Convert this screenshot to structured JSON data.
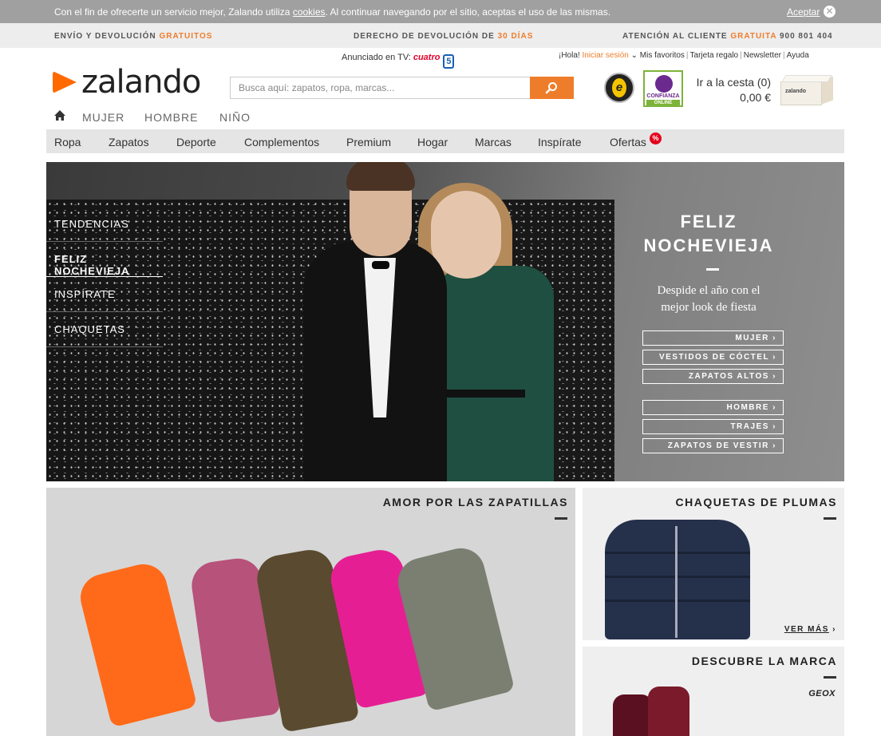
{
  "cookie_bar": {
    "message_before": "Con el fin de ofrecerte un servicio mejor, Zalando utiliza ",
    "cookies_link": "cookies",
    "message_after": ". Al continuar navegando por el sitio, aceptas el uso de las mismas.",
    "accept_label": "Aceptar",
    "close_icon": "close-icon"
  },
  "service_bar": {
    "shipping": {
      "text": "ENVÍO Y DEVOLUCIÓN",
      "highlight": "GRATUITOS"
    },
    "returns": {
      "text": "DERECHO DE DEVOLUCIÓN DE",
      "highlight": "30 DÍAS"
    },
    "support": {
      "text": "ATENCIÓN AL CLIENTE",
      "highlight": "GRATUITA",
      "phone": "900 801 404"
    }
  },
  "header": {
    "logo_text": "zalando",
    "tv_label": "Anunciado en TV:",
    "tv_channel_1": "cuatro",
    "tv_channel_2": "5",
    "search_placeholder": "Busca aquí: zapatos, ropa, marcas...",
    "top_links": {
      "greeting": "¡Hola!",
      "login": "Iniciar sesión",
      "favorites": "Mis favoritos",
      "gift_card": "Tarjeta regalo",
      "newsletter": "Newsletter",
      "help": "Ayuda"
    },
    "trust_badge_1": "e",
    "trust_badge_2_line1": "CONFIANZA",
    "trust_badge_2_line2": "ONLINE",
    "cart_label": "Ir a la cesta (0)",
    "cart_total": "0,00 €",
    "cart_box_label": "zalando"
  },
  "gender_nav": {
    "home_icon": "home-icon",
    "items": [
      "MUJER",
      "HOMBRE",
      "NIÑO"
    ]
  },
  "category_nav": {
    "items": [
      "Ropa",
      "Zapatos",
      "Deporte",
      "Complementos",
      "Premium",
      "Hogar",
      "Marcas",
      "Inspírate",
      "Ofertas"
    ],
    "offers_badge": "%"
  },
  "hero": {
    "menu": [
      "TENDENCIAS",
      "FELIZ NOCHEVIEJA",
      "INSPÍRATE",
      "CHAQUETAS"
    ],
    "title_line1": "FELIZ",
    "title_line2": "NOCHEVIEJA",
    "subtitle_line1": "Despide el año con el",
    "subtitle_line2": "mejor look de fiesta",
    "buttons_women": [
      "MUJER ›",
      "VESTIDOS DE CÓCTEL ›",
      "ZAPATOS ALTOS ›"
    ],
    "buttons_men": [
      "HOMBRE ›",
      "TRAJES ›",
      "ZAPATOS DE VESTIR ›"
    ]
  },
  "tiles": {
    "sneakers_title": "AMOR POR LAS ZAPATILLAS",
    "jackets_title": "CHAQUETAS DE PLUMAS",
    "jackets_link": "VER MÁS",
    "jackets_link_arrow": "›",
    "brand_title": "DESCUBRE LA MARCA",
    "brand_name": "GEOX"
  },
  "colors": {
    "accent": "#ee7d2b",
    "logo": "#ff6900",
    "sale": "#e3001b"
  }
}
